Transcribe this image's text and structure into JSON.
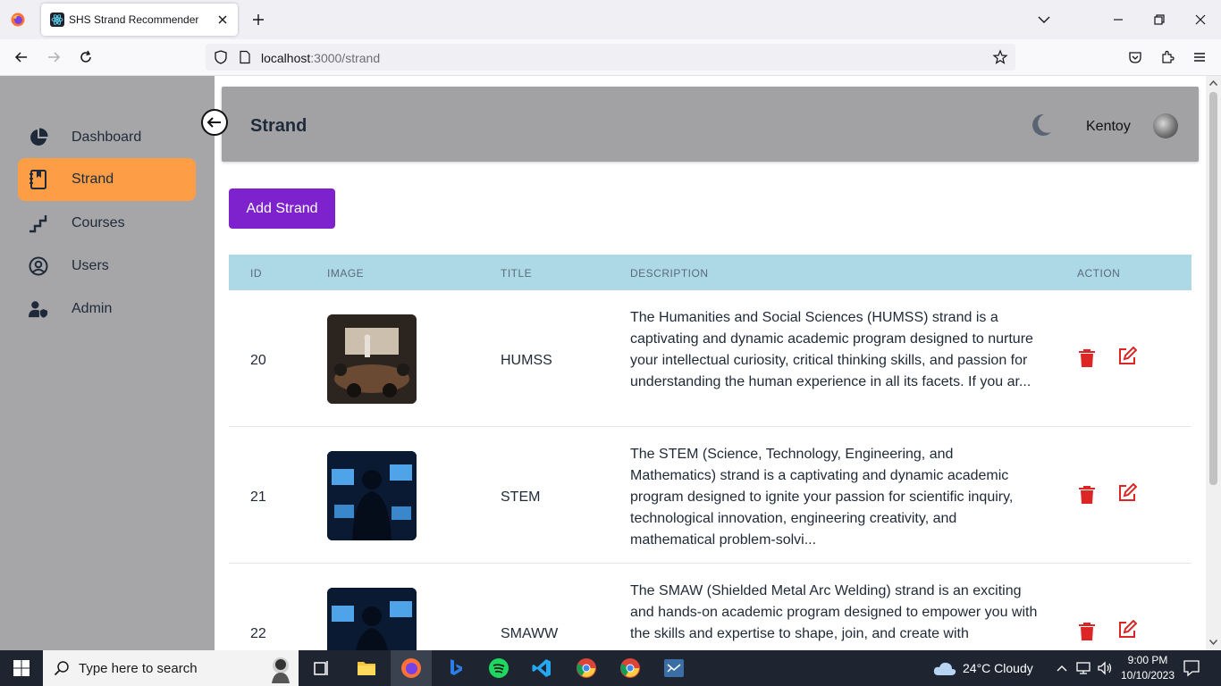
{
  "browser": {
    "tab_title": "SHS Strand Recommender",
    "url_host": "localhost",
    "url_path": ":3000/strand"
  },
  "sidebar": {
    "items": [
      {
        "label": "Dashboard",
        "icon": "pie-chart-icon"
      },
      {
        "label": "Strand",
        "icon": "book-icon",
        "active": true
      },
      {
        "label": "Courses",
        "icon": "stairs-icon"
      },
      {
        "label": "Users",
        "icon": "user-circle-icon"
      },
      {
        "label": "Admin",
        "icon": "user-shield-icon"
      }
    ]
  },
  "header": {
    "title": "Strand",
    "username": "Kentoy"
  },
  "actions": {
    "add_label": "Add Strand"
  },
  "table": {
    "columns": [
      "ID",
      "IMAGE",
      "TITLE",
      "DESCRIPTION",
      "ACTION"
    ],
    "rows": [
      {
        "id": "20",
        "title": "HUMSS",
        "description": "The Humanities and Social Sciences (HUMSS) strand is a captivating and dynamic academic program designed to nurture your intellectual curiosity, critical thinking skills, and passion for understanding the human experience in all its facets. If you ar..."
      },
      {
        "id": "21",
        "title": "STEM",
        "description": "The STEM (Science, Technology, Engineering, and Mathematics) strand is a captivating and dynamic academic program designed to ignite your passion for scientific inquiry, technological innovation, engineering creativity, and mathematical problem-solvi..."
      },
      {
        "id": "22",
        "title": "SMAWW",
        "description": "The SMAW (Shielded Metal Arc Welding) strand is an exciting and hands-on academic program designed to empower you with the skills and expertise to shape, join, and create with"
      }
    ]
  },
  "taskbar": {
    "search_placeholder": "Type here to search",
    "weather": "24°C  Cloudy",
    "time": "9:00 PM",
    "date": "10/10/2023"
  },
  "colors": {
    "sidebar_bg": "#a6a6a8",
    "active_item": "#fd9e46",
    "primary_button": "#7e22ce",
    "table_header": "#add8e6",
    "danger": "#dc2626"
  }
}
